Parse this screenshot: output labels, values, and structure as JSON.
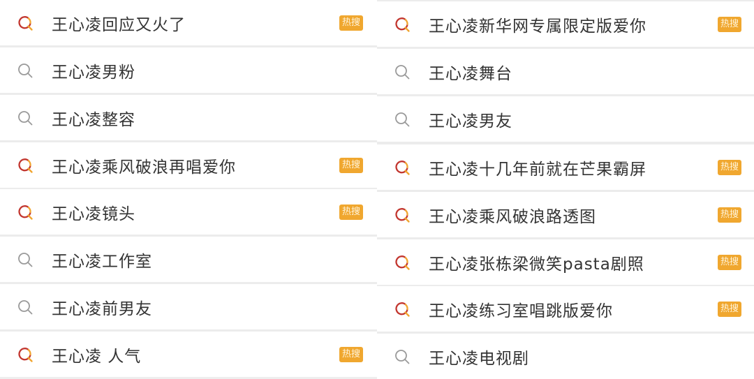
{
  "hot_badge_color": "#f0a72f",
  "left_column": [
    {
      "label": "王心凌回应又火了",
      "icon": "hot-search-icon",
      "badge": "热搜"
    },
    {
      "label": "王心凌男粉",
      "icon": "search-icon",
      "badge": null
    },
    {
      "label": "王心凌整容",
      "icon": "search-icon",
      "badge": null
    },
    {
      "label": "王心凌乘风破浪再唱爱你",
      "icon": "hot-search-icon",
      "badge": "热搜"
    },
    {
      "label": "王心凌镜头",
      "icon": "hot-search-icon",
      "badge": "热搜"
    },
    {
      "label": "王心凌工作室",
      "icon": "search-icon",
      "badge": null
    },
    {
      "label": "王心凌前男友",
      "icon": "search-icon",
      "badge": null
    },
    {
      "label": "王心凌 人气",
      "icon": "hot-search-icon",
      "badge": "热搜"
    }
  ],
  "right_column": [
    {
      "label": "王心凌新华网专属限定版爱你",
      "icon": "hot-search-icon",
      "badge": "热搜"
    },
    {
      "label": "王心凌舞台",
      "icon": "search-icon",
      "badge": null
    },
    {
      "label": "王心凌男友",
      "icon": "search-icon",
      "badge": null
    },
    {
      "label": "王心凌十几年前就在芒果霸屏",
      "icon": "hot-search-icon",
      "badge": "热搜"
    },
    {
      "label": "王心凌乘风破浪路透图",
      "icon": "hot-search-icon",
      "badge": "热搜"
    },
    {
      "label": "王心凌张栋梁微笑pasta剧照",
      "icon": "hot-search-icon",
      "badge": "热搜"
    },
    {
      "label": "王心凌练习室唱跳版爱你",
      "icon": "hot-search-icon",
      "badge": "热搜"
    },
    {
      "label": "王心凌电视剧",
      "icon": "search-icon",
      "badge": null
    }
  ]
}
